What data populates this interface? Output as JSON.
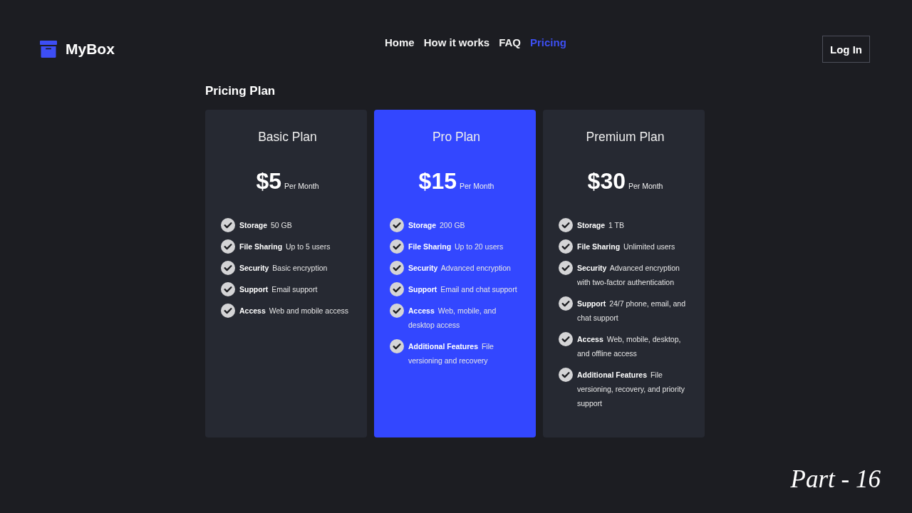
{
  "brand": {
    "name": "MyBox"
  },
  "nav": [
    {
      "label": "Home",
      "selected": false
    },
    {
      "label": "How it works",
      "selected": false
    },
    {
      "label": "FAQ",
      "selected": false
    },
    {
      "label": "Pricing",
      "selected": true
    }
  ],
  "login_button": {
    "label": "Log In"
  },
  "section_title": "Pricing Plan",
  "plans": [
    {
      "name": "Basic Plan",
      "highlighted": false,
      "price": "$5",
      "period": "Per Month",
      "features": [
        "**Storage** 50 GB",
        "**File Sharing** Up to 5 users",
        "**Security** Basic encryption",
        "**Support** Email support",
        "**Access** Web and mobile access"
      ]
    },
    {
      "name": "Pro Plan",
      "highlighted": true,
      "price": "$15",
      "period": "Per Month",
      "features": [
        "**Storage** 200 GB",
        "**File Sharing** Up to 20 users",
        "**Security** Advanced encryption",
        "**Support** Email and chat support",
        "**Access** Web, mobile, and desktop access",
        "**Additional Features** File versioning and recovery"
      ]
    },
    {
      "name": "Premium Plan",
      "highlighted": false,
      "price": "$30",
      "period": "Per Month",
      "features": [
        "**Storage** 1 TB",
        "**File Sharing** Unlimited users",
        "**Security** Advanced encryption with two-factor authentication",
        "**Support** 24/7 phone, email, and chat support",
        "**Access** Web, mobile, desktop, and offline access",
        "**Additional Features** File versioning, recovery, and priority support"
      ]
    }
  ],
  "overlay_caption": "Part - 16"
}
